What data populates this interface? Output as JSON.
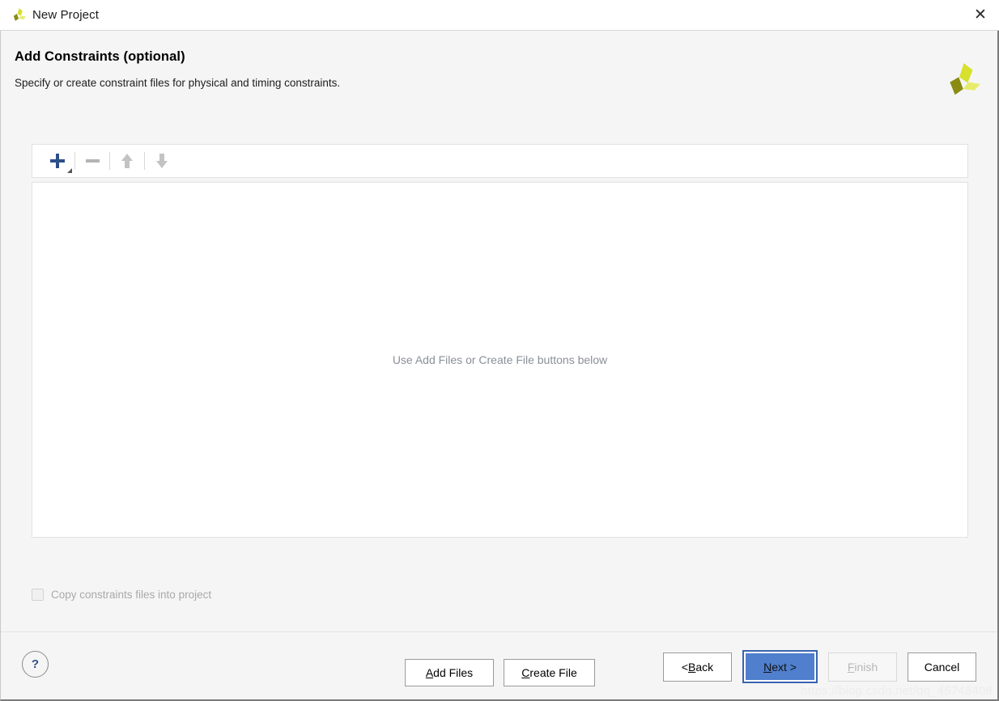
{
  "window": {
    "title": "New Project",
    "logo_icon": "vivado-pinwheel-logo",
    "close_icon": "close-icon",
    "close_label": "✕"
  },
  "header": {
    "title": "Add Constraints (optional)",
    "subtitle": "Specify or create constraint files for physical and timing constraints.",
    "brand_icon": "vivado-pinwheel-logo"
  },
  "toolbar": {
    "items": [
      {
        "name": "add-button",
        "icon": "plus-icon",
        "enabled": true
      },
      {
        "name": "remove-button",
        "icon": "minus-icon",
        "enabled": false
      },
      {
        "name": "move-up-button",
        "icon": "arrow-up-icon",
        "enabled": false
      },
      {
        "name": "move-down-button",
        "icon": "arrow-down-icon",
        "enabled": false
      }
    ]
  },
  "file_list": {
    "empty_message": "Use Add Files or Create File buttons below",
    "rows": []
  },
  "actions": {
    "add_files": {
      "prefix": "",
      "mnemonic": "A",
      "suffix": "dd Files"
    },
    "create_file": {
      "prefix": "",
      "mnemonic": "C",
      "suffix": "reate File"
    }
  },
  "options": {
    "copy_constraints": {
      "label": "Copy constraints files into project",
      "checked": false,
      "enabled": false
    }
  },
  "footer": {
    "help_label": "?",
    "buttons": [
      {
        "name": "back-button",
        "prefix": "< ",
        "mnemonic": "B",
        "suffix": "ack",
        "state": "normal"
      },
      {
        "name": "next-button",
        "prefix": "",
        "mnemonic": "N",
        "suffix": "ext >",
        "state": "primary"
      },
      {
        "name": "finish-button",
        "prefix": "",
        "mnemonic": "F",
        "suffix": "inish",
        "state": "disabled"
      },
      {
        "name": "cancel-button",
        "prefix": "",
        "mnemonic": "",
        "suffix": "Cancel",
        "state": "normal"
      }
    ]
  },
  "watermark": {
    "text": "https://blog.csdn.net/qq_45748408"
  },
  "colors": {
    "accent_blue": "#2d4f88",
    "primary_button": "#4f7fcd",
    "primary_border": "#3a63b0",
    "dialog_bg": "#f5f5f5",
    "panel_bg": "#ffffff",
    "muted_text": "#8a8f98",
    "disabled_text": "#b7b7b7",
    "logo_olive": "#8a8c12",
    "logo_yellow": "#d7e02b"
  }
}
